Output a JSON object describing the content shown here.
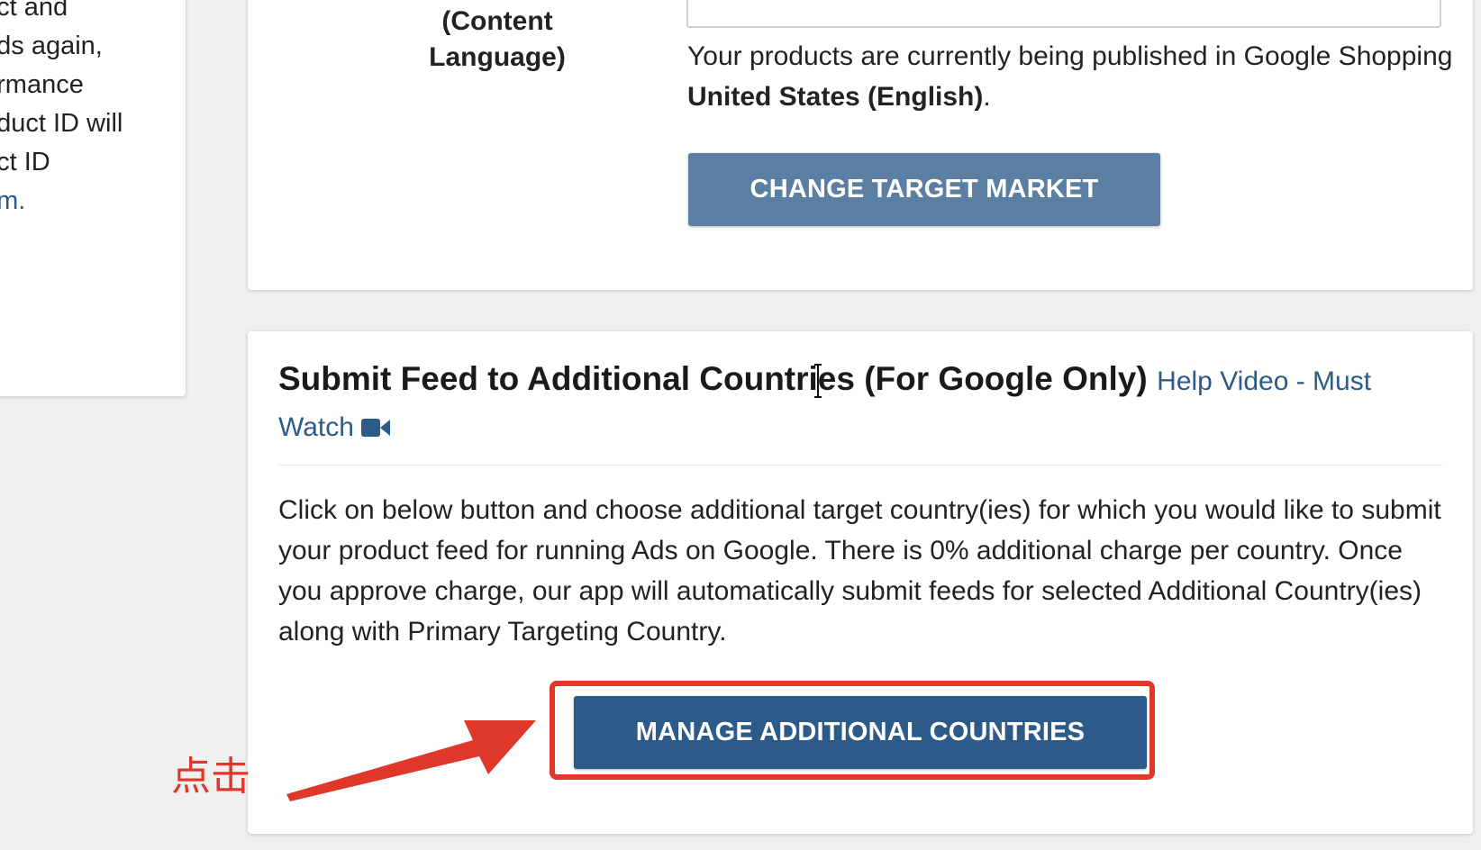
{
  "left_panel": {
    "lines": [
      "uct and",
      "ads again,",
      "ormance",
      "oduct ID will",
      "uct ID",
      "om."
    ]
  },
  "target_market": {
    "label": "(Content Language)",
    "status_prefix": "Your products are currently being published in Google Shopping ",
    "status_market": "United States (English)",
    "status_suffix": ".",
    "change_button": "CHANGE TARGET MARKET"
  },
  "additional_countries": {
    "title": "Submit Feed to Additional Countries (For Google Only)",
    "help_link": "Help Video - Must Watch",
    "help_icon": "video-camera-icon",
    "description": "Click on below button and choose additional target country(ies) for which you would like to submit your product feed for running Ads on Google. There is 0% additional charge per country. Once you approve charge, our app will automatically submit feeds for selected Additional Country(ies) along with Primary Targeting Country.",
    "manage_button": "MANAGE ADDITIONAL COUNTRIES"
  },
  "annotation": {
    "text": "点击",
    "color": "#e0372b"
  },
  "colors": {
    "primary_button": "#2c5b8a",
    "secondary_button": "#5a7fa3",
    "link": "#2c5b8a",
    "highlight": "#e0372b"
  }
}
